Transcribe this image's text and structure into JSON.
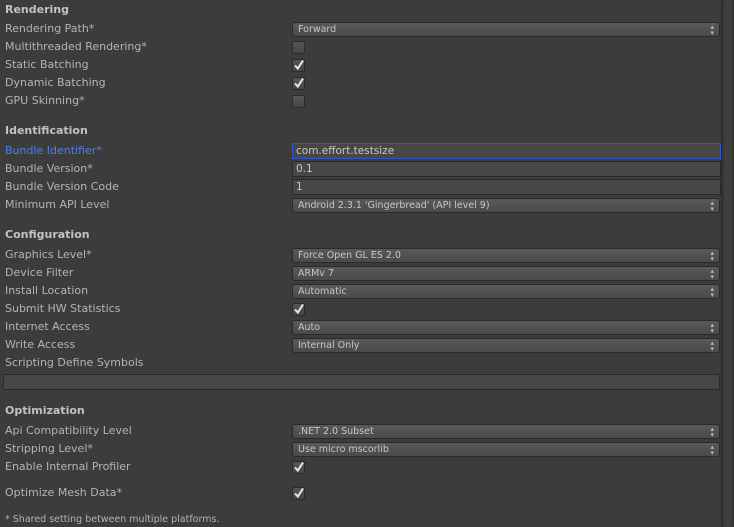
{
  "sections": [
    {
      "title": "Rendering",
      "rows": [
        {
          "label": "Rendering Path*",
          "type": "popup",
          "value": "Forward"
        },
        {
          "label": "Multithreaded Rendering*",
          "type": "checkbox",
          "checked": false
        },
        {
          "label": "Static Batching",
          "type": "checkbox",
          "checked": true
        },
        {
          "label": "Dynamic Batching",
          "type": "checkbox",
          "checked": true
        },
        {
          "label": "GPU Skinning*",
          "type": "checkbox",
          "checked": false
        }
      ]
    },
    {
      "title": "Identification",
      "rows": [
        {
          "label": "Bundle Identifier*",
          "type": "text",
          "value": "com.effort.testsize",
          "focused": true
        },
        {
          "label": "Bundle Version*",
          "type": "text",
          "value": "0.1"
        },
        {
          "label": "Bundle Version Code",
          "type": "text",
          "value": "1"
        },
        {
          "label": "Minimum API Level",
          "type": "popup",
          "value": "Android 2.3.1 'Gingerbread' (API level 9)"
        }
      ]
    },
    {
      "title": "Configuration",
      "rows": [
        {
          "label": "Graphics Level*",
          "type": "popup",
          "value": "Force Open GL ES 2.0"
        },
        {
          "label": "Device Filter",
          "type": "popup",
          "value": "ARMv 7"
        },
        {
          "label": "Install Location",
          "type": "popup",
          "value": "Automatic"
        },
        {
          "label": "Submit HW Statistics",
          "type": "checkbox",
          "checked": true
        },
        {
          "label": "Internet Access",
          "type": "popup",
          "value": "Auto"
        },
        {
          "label": "Write Access",
          "type": "popup",
          "value": "Internal Only"
        },
        {
          "label": "Scripting Define Symbols",
          "type": "widetext",
          "value": ""
        }
      ]
    },
    {
      "title": "Optimization",
      "rows": [
        {
          "label": "Api Compatibility Level",
          "type": "popup",
          "value": ".NET 2.0 Subset"
        },
        {
          "label": "Stripping Level*",
          "type": "popup",
          "value": "Use micro mscorlib"
        },
        {
          "label": "Enable Internal Profiler",
          "type": "checkbox",
          "checked": true
        },
        {
          "label": "Optimize Mesh Data*",
          "type": "checkbox",
          "checked": true
        }
      ]
    }
  ],
  "footnote": "* Shared setting between multiple platforms.",
  "colors": {
    "background": "#3c3c3c",
    "text": "#b4b4b4",
    "focus_label": "#4f7fe6",
    "focus_border": "#3355cc"
  }
}
